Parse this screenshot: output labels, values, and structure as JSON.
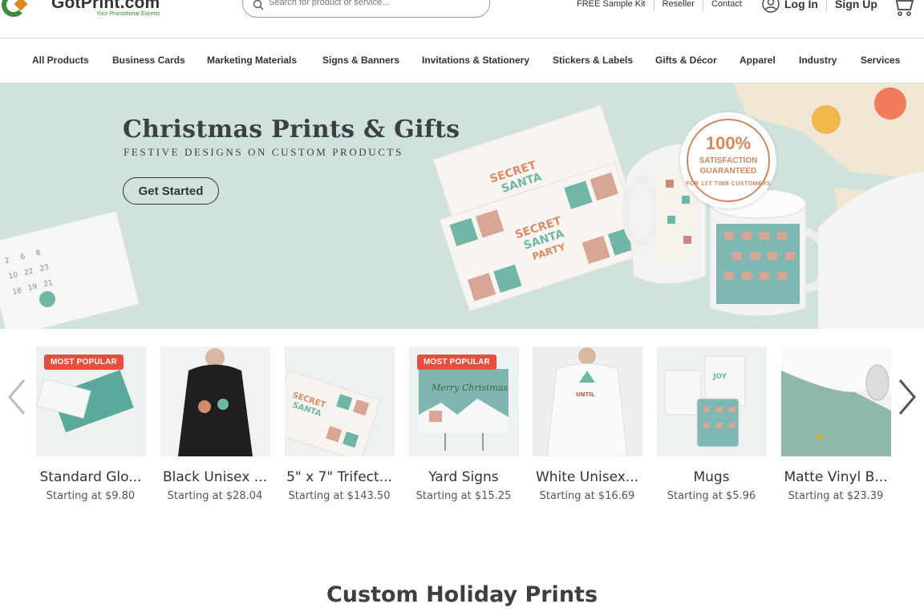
{
  "brand": {
    "name": "GotPrint.com",
    "tagline": "Your Promotional Experts"
  },
  "search": {
    "placeholder": "Search for product or service..."
  },
  "top_links": [
    "FREE Sample Kit",
    "Reseller",
    "Contact"
  ],
  "account": {
    "login": "Log In",
    "signup": "Sign Up"
  },
  "nav": [
    "All Products",
    "Business Cards",
    "Marketing Materials",
    "Signs & Banners",
    "Invitations & Stationery",
    "Stickers & Labels",
    "Gifts & Décor",
    "Apparel",
    "Industry",
    "Services"
  ],
  "hero": {
    "title": "Christmas Prints & Gifts",
    "subtitle": "FESTIVE DESIGNS ON CUSTOM PRODUCTS",
    "cta": "Get Started",
    "badge": {
      "percent": "100%",
      "line1": "SATISFACTION",
      "line2": "GUARANTEED",
      "line3": "FOR 1ST TIME CUSTOMERS"
    }
  },
  "products": [
    {
      "name": "Standard Glo...",
      "price": "Starting at $9.80",
      "badge": "MOST POPULAR",
      "thumb_color": "#eef1f1"
    },
    {
      "name": "Black Unisex ...",
      "price": "Starting at $28.04",
      "badge": "",
      "thumb_color": "#f2f2f2"
    },
    {
      "name": "5\" x 7\" Trifect...",
      "price": "Starting at $143.50",
      "badge": "",
      "thumb_color": "#eef2ef"
    },
    {
      "name": "Yard Signs",
      "price": "Starting at $15.25",
      "badge": "MOST POPULAR",
      "thumb_color": "#e9efee"
    },
    {
      "name": "White Unisex...",
      "price": "Starting at $16.69",
      "badge": "",
      "thumb_color": "#eef0f0"
    },
    {
      "name": "Mugs",
      "price": "Starting at $5.96",
      "badge": "",
      "thumb_color": "#e7ecec"
    },
    {
      "name": "Matte Vinyl B...",
      "price": "Starting at $23.39",
      "badge": "",
      "thumb_color": "#ecf0ef"
    }
  ],
  "section": {
    "title": "Custom Holiday Prints"
  },
  "colors": {
    "hero_bg": "#cfe3dc",
    "badge_red": "#e94e3c",
    "accent_green": "#3a8a3a",
    "accent_orange": "#e08a1e"
  }
}
